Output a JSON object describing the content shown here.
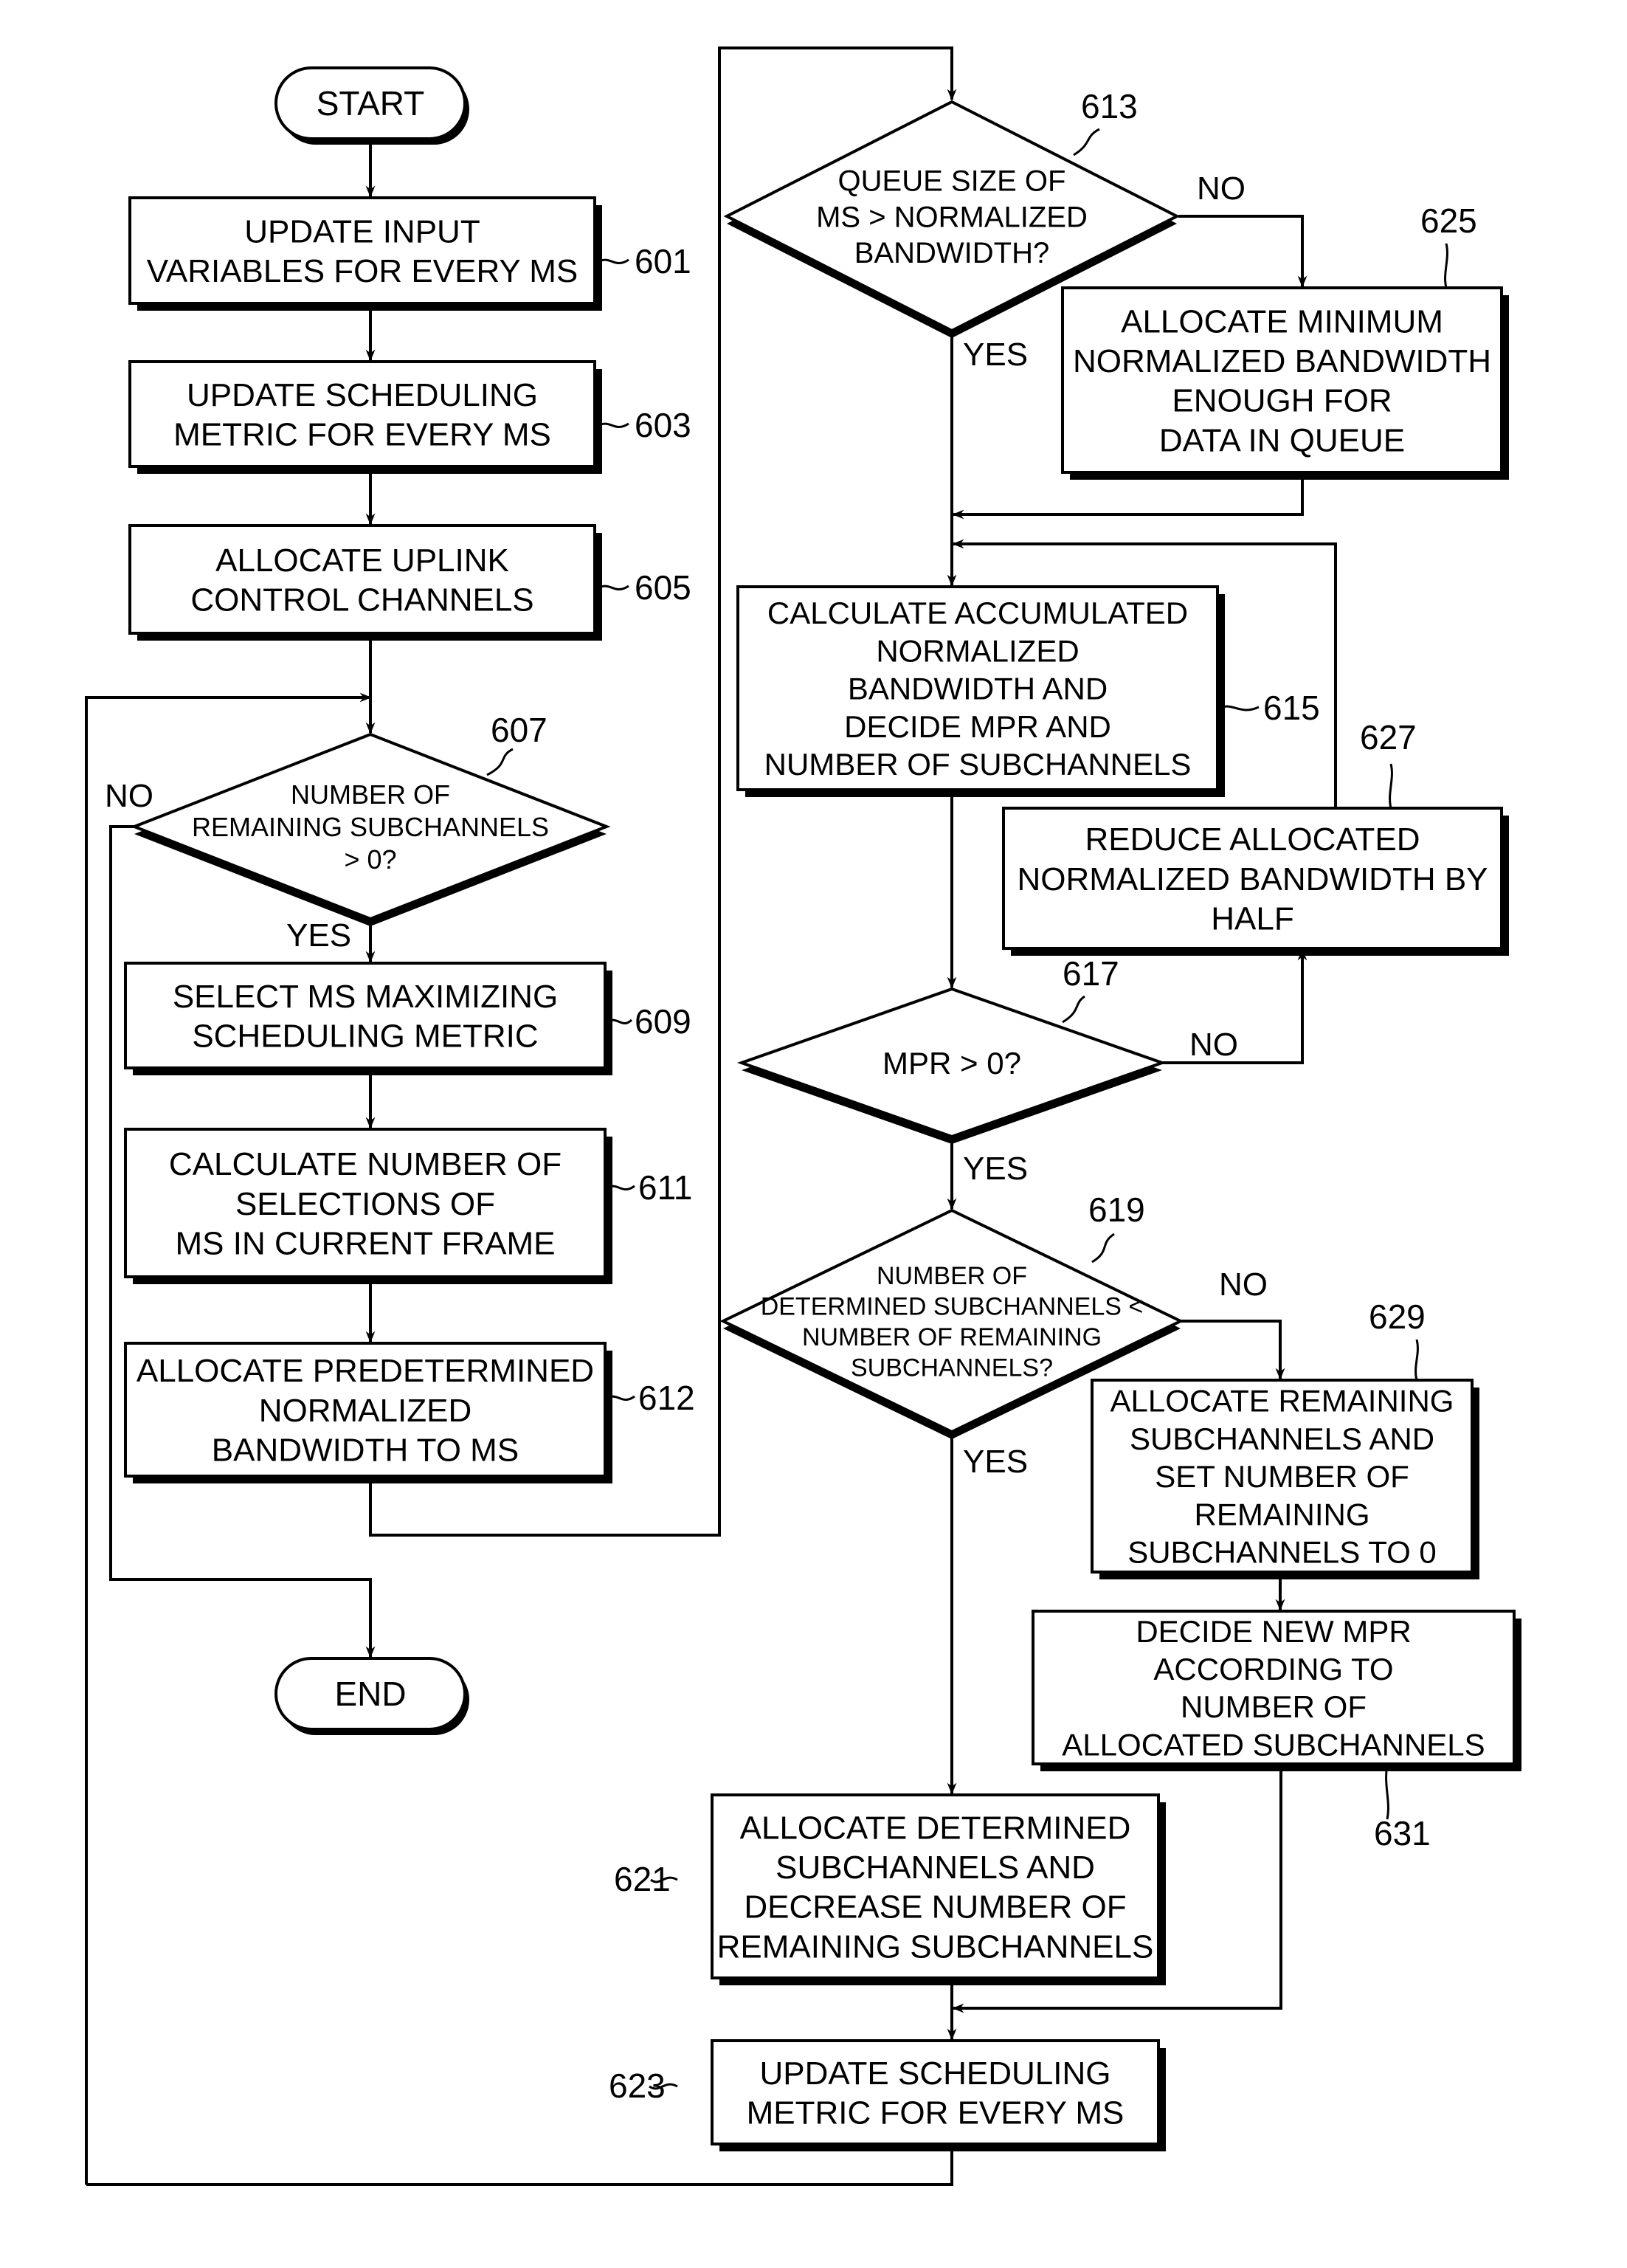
{
  "figure": {
    "terminals": {
      "start": "START",
      "end": "END"
    },
    "steps": {
      "s601": {
        "ref": "601",
        "lines": [
          "UPDATE INPUT",
          "VARIABLES FOR EVERY MS"
        ]
      },
      "s603": {
        "ref": "603",
        "lines": [
          "UPDATE SCHEDULING",
          "METRIC FOR EVERY MS"
        ]
      },
      "s605": {
        "ref": "605",
        "lines": [
          "ALLOCATE UPLINK",
          "CONTROL CHANNELS"
        ]
      },
      "s607": {
        "ref": "607",
        "lines": [
          "NUMBER OF",
          "REMAINING SUBCHANNELS",
          "> 0?"
        ]
      },
      "s609": {
        "ref": "609",
        "lines": [
          "SELECT MS MAXIMIZING",
          "SCHEDULING METRIC"
        ]
      },
      "s611": {
        "ref": "611",
        "lines": [
          "CALCULATE NUMBER OF",
          "SELECTIONS OF",
          "MS IN CURRENT FRAME"
        ]
      },
      "s612": {
        "ref": "612",
        "lines": [
          "ALLOCATE PREDETERMINED",
          "NORMALIZED",
          "BANDWIDTH TO MS"
        ]
      },
      "s613": {
        "ref": "613",
        "lines": [
          "QUEUE SIZE OF",
          "MS > NORMALIZED",
          "BANDWIDTH?"
        ]
      },
      "s615": {
        "ref": "615",
        "lines": [
          "CALCULATE ACCUMULATED",
          "NORMALIZED",
          "BANDWIDTH AND",
          "DECIDE MPR AND",
          "NUMBER OF SUBCHANNELS"
        ]
      },
      "s617": {
        "ref": "617",
        "lines": [
          "MPR > 0?"
        ]
      },
      "s619": {
        "ref": "619",
        "lines": [
          "NUMBER OF",
          "DETERMINED SUBCHANNELS <",
          "NUMBER OF REMAINING",
          "SUBCHANNELS?"
        ]
      },
      "s621": {
        "ref": "621",
        "lines": [
          "ALLOCATE DETERMINED",
          "SUBCHANNELS AND",
          "DECREASE NUMBER OF",
          "REMAINING SUBCHANNELS"
        ]
      },
      "s623": {
        "ref": "623",
        "lines": [
          "UPDATE SCHEDULING",
          "METRIC FOR EVERY MS"
        ]
      },
      "s625": {
        "ref": "625",
        "lines": [
          "ALLOCATE MINIMUM",
          "NORMALIZED BANDWIDTH",
          "ENOUGH FOR",
          "DATA IN QUEUE"
        ]
      },
      "s627": {
        "ref": "627",
        "lines": [
          "REDUCE ALLOCATED",
          "NORMALIZED BANDWIDTH BY",
          "HALF"
        ]
      },
      "s629": {
        "ref": "629",
        "lines": [
          "ALLOCATE REMAINING",
          "SUBCHANNELS AND",
          "SET NUMBER OF",
          "REMAINING",
          "SUBCHANNELS TO 0"
        ]
      },
      "s631": {
        "ref": "631",
        "lines": [
          "DECIDE NEW MPR",
          "ACCORDING TO",
          "NUMBER OF",
          "ALLOCATED SUBCHANNELS"
        ]
      }
    },
    "branch_labels": {
      "yes": "YES",
      "no": "NO"
    }
  }
}
